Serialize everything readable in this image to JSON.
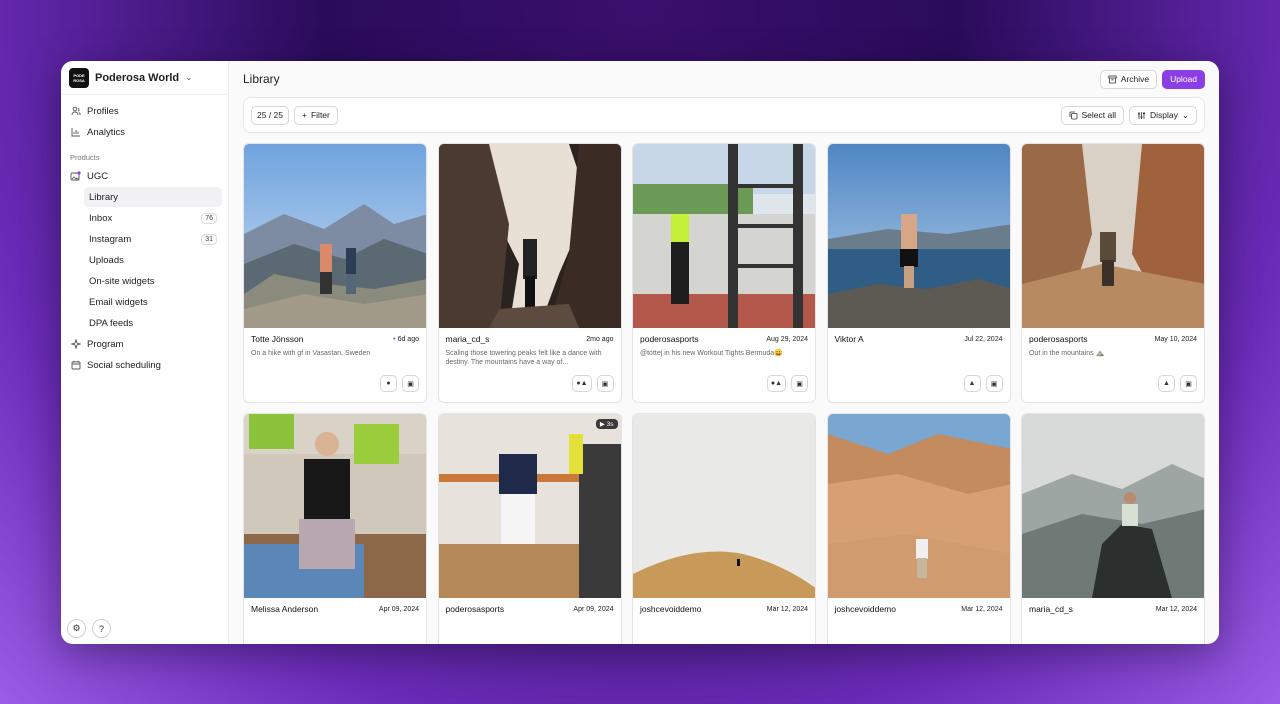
{
  "workspace": {
    "name": "Poderosa World",
    "logo_text": "PODE ROSA"
  },
  "sidebar": {
    "top_items": [
      {
        "label": "Profiles",
        "icon": "users-icon"
      },
      {
        "label": "Analytics",
        "icon": "chart-icon"
      }
    ],
    "section_label": "Products",
    "ugc_label": "UGC",
    "sub_items": [
      {
        "label": "Library",
        "badge": ""
      },
      {
        "label": "Inbox",
        "badge": "76"
      },
      {
        "label": "Instagram",
        "badge": "31"
      },
      {
        "label": "Uploads",
        "badge": ""
      },
      {
        "label": "On-site widgets",
        "badge": ""
      },
      {
        "label": "Email widgets",
        "badge": ""
      },
      {
        "label": "DPA feeds",
        "badge": ""
      }
    ],
    "bottom_items": [
      {
        "label": "Program",
        "icon": "sparkle-icon"
      },
      {
        "label": "Social scheduling",
        "icon": "calendar-icon"
      }
    ],
    "help_label": "?"
  },
  "header": {
    "title": "Library",
    "archive_label": "Archive",
    "upload_label": "Upload"
  },
  "toolbar": {
    "count": "25 / 25",
    "filter_label": "Filter",
    "select_all_label": "Select all",
    "display_label": "Display"
  },
  "cards": [
    {
      "author": "Totte Jönsson",
      "date": "6d ago",
      "new": true,
      "caption": "On a hike with gf in Vasastan, Sweden",
      "icon_a": "●"
    },
    {
      "author": "maria_cd_s",
      "date": "2mo ago",
      "new": false,
      "caption": "Scaling those towering peaks felt like a dance with destiny. The mountains have a way of...",
      "icon_a": "●▲"
    },
    {
      "author": "poderosasports",
      "date": "Aug 29, 2024",
      "new": false,
      "caption": "@tottej in his new Workout Tights Bermuda😀",
      "icon_a": "●▲"
    },
    {
      "author": "Viktor A",
      "date": "Jul 22, 2024",
      "new": false,
      "caption": "",
      "icon_a": "▲"
    },
    {
      "author": "poderosasports",
      "date": "May 10, 2024",
      "new": false,
      "caption": "Out in the mountains ⛰️",
      "icon_a": "▲"
    },
    {
      "author": "Melissa Anderson",
      "date": "Apr 09, 2024",
      "new": false,
      "caption": ""
    },
    {
      "author": "poderosasports",
      "date": "Apr 09, 2024",
      "new": false,
      "caption": "",
      "video": "3s"
    },
    {
      "author": "joshcevoiddemo",
      "date": "Mar 12, 2024",
      "new": false,
      "caption": ""
    },
    {
      "author": "joshcevoiddemo",
      "date": "Mar 12, 2024",
      "new": false,
      "caption": ""
    },
    {
      "author": "maria_cd_s",
      "date": "Mar 12, 2024",
      "new": false,
      "caption": ""
    }
  ],
  "colors": {
    "accent": "#8b3ee6"
  }
}
